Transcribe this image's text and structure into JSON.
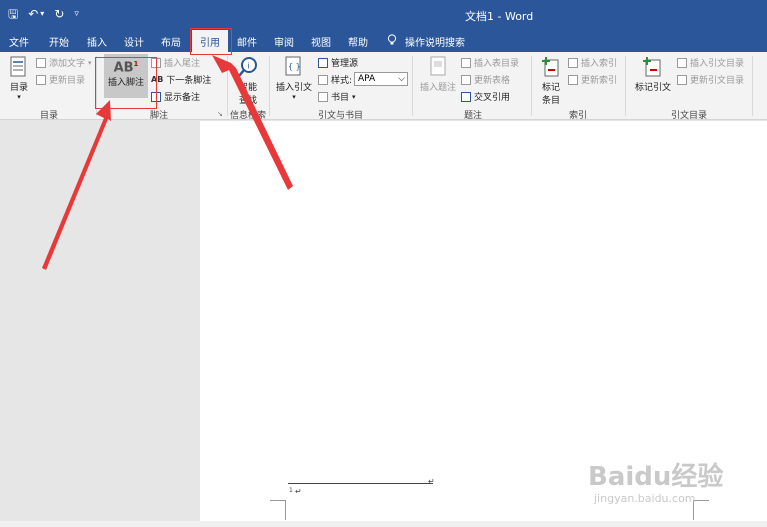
{
  "window": {
    "title": "文档1 - Word"
  },
  "qat": {
    "save": "🖫",
    "undo": "↶",
    "undo_arrow": "▾",
    "redo": "↻",
    "customize": "▿"
  },
  "tabs": [
    "文件",
    "开始",
    "插入",
    "设计",
    "布局",
    "引用",
    "邮件",
    "审阅",
    "视图",
    "帮助"
  ],
  "active_tab": "引用",
  "tell_me": "操作说明搜索",
  "ribbon": {
    "toc": {
      "button": "目录",
      "add_text": "添加文字",
      "update_toc": "更新目录",
      "label": "目录"
    },
    "footnotes": {
      "insert_footnote": "插入脚注",
      "icon_text": "AB",
      "icon_sup": "1",
      "insert_endnote": "插入尾注",
      "next_footnote": "下一条脚注",
      "show_notes": "显示备注",
      "label": "脚注"
    },
    "research": {
      "smart_lookup": [
        "智能",
        "查找"
      ],
      "label": "信息检索"
    },
    "citations": {
      "insert_citation": "插入引文",
      "manage_sources": "管理源",
      "style_label": "样式:",
      "style_value": "APA",
      "bibliography": "书目",
      "label": "引文与书目"
    },
    "captions": {
      "insert_caption": "插入题注",
      "insert_table_figures": "插入表目录",
      "update_table": "更新表格",
      "cross_reference": "交叉引用",
      "label": "题注"
    },
    "index": {
      "mark_entry": [
        "标记",
        "条目"
      ],
      "insert_index": "插入索引",
      "update_index": "更新索引",
      "label": "索引"
    },
    "toa": {
      "mark_citation": "标记引文",
      "insert_toa": "插入引文目录",
      "update_toa": "更新引文目录",
      "label": "引文目录"
    }
  },
  "document": {
    "footnote_number": "1",
    "paragraph_mark": "↵"
  },
  "watermark": {
    "brand": "Baidu经验",
    "url": "jingyan.baidu.com"
  },
  "colors": {
    "brand": "#2b579a",
    "annotation": "#e8393a"
  }
}
